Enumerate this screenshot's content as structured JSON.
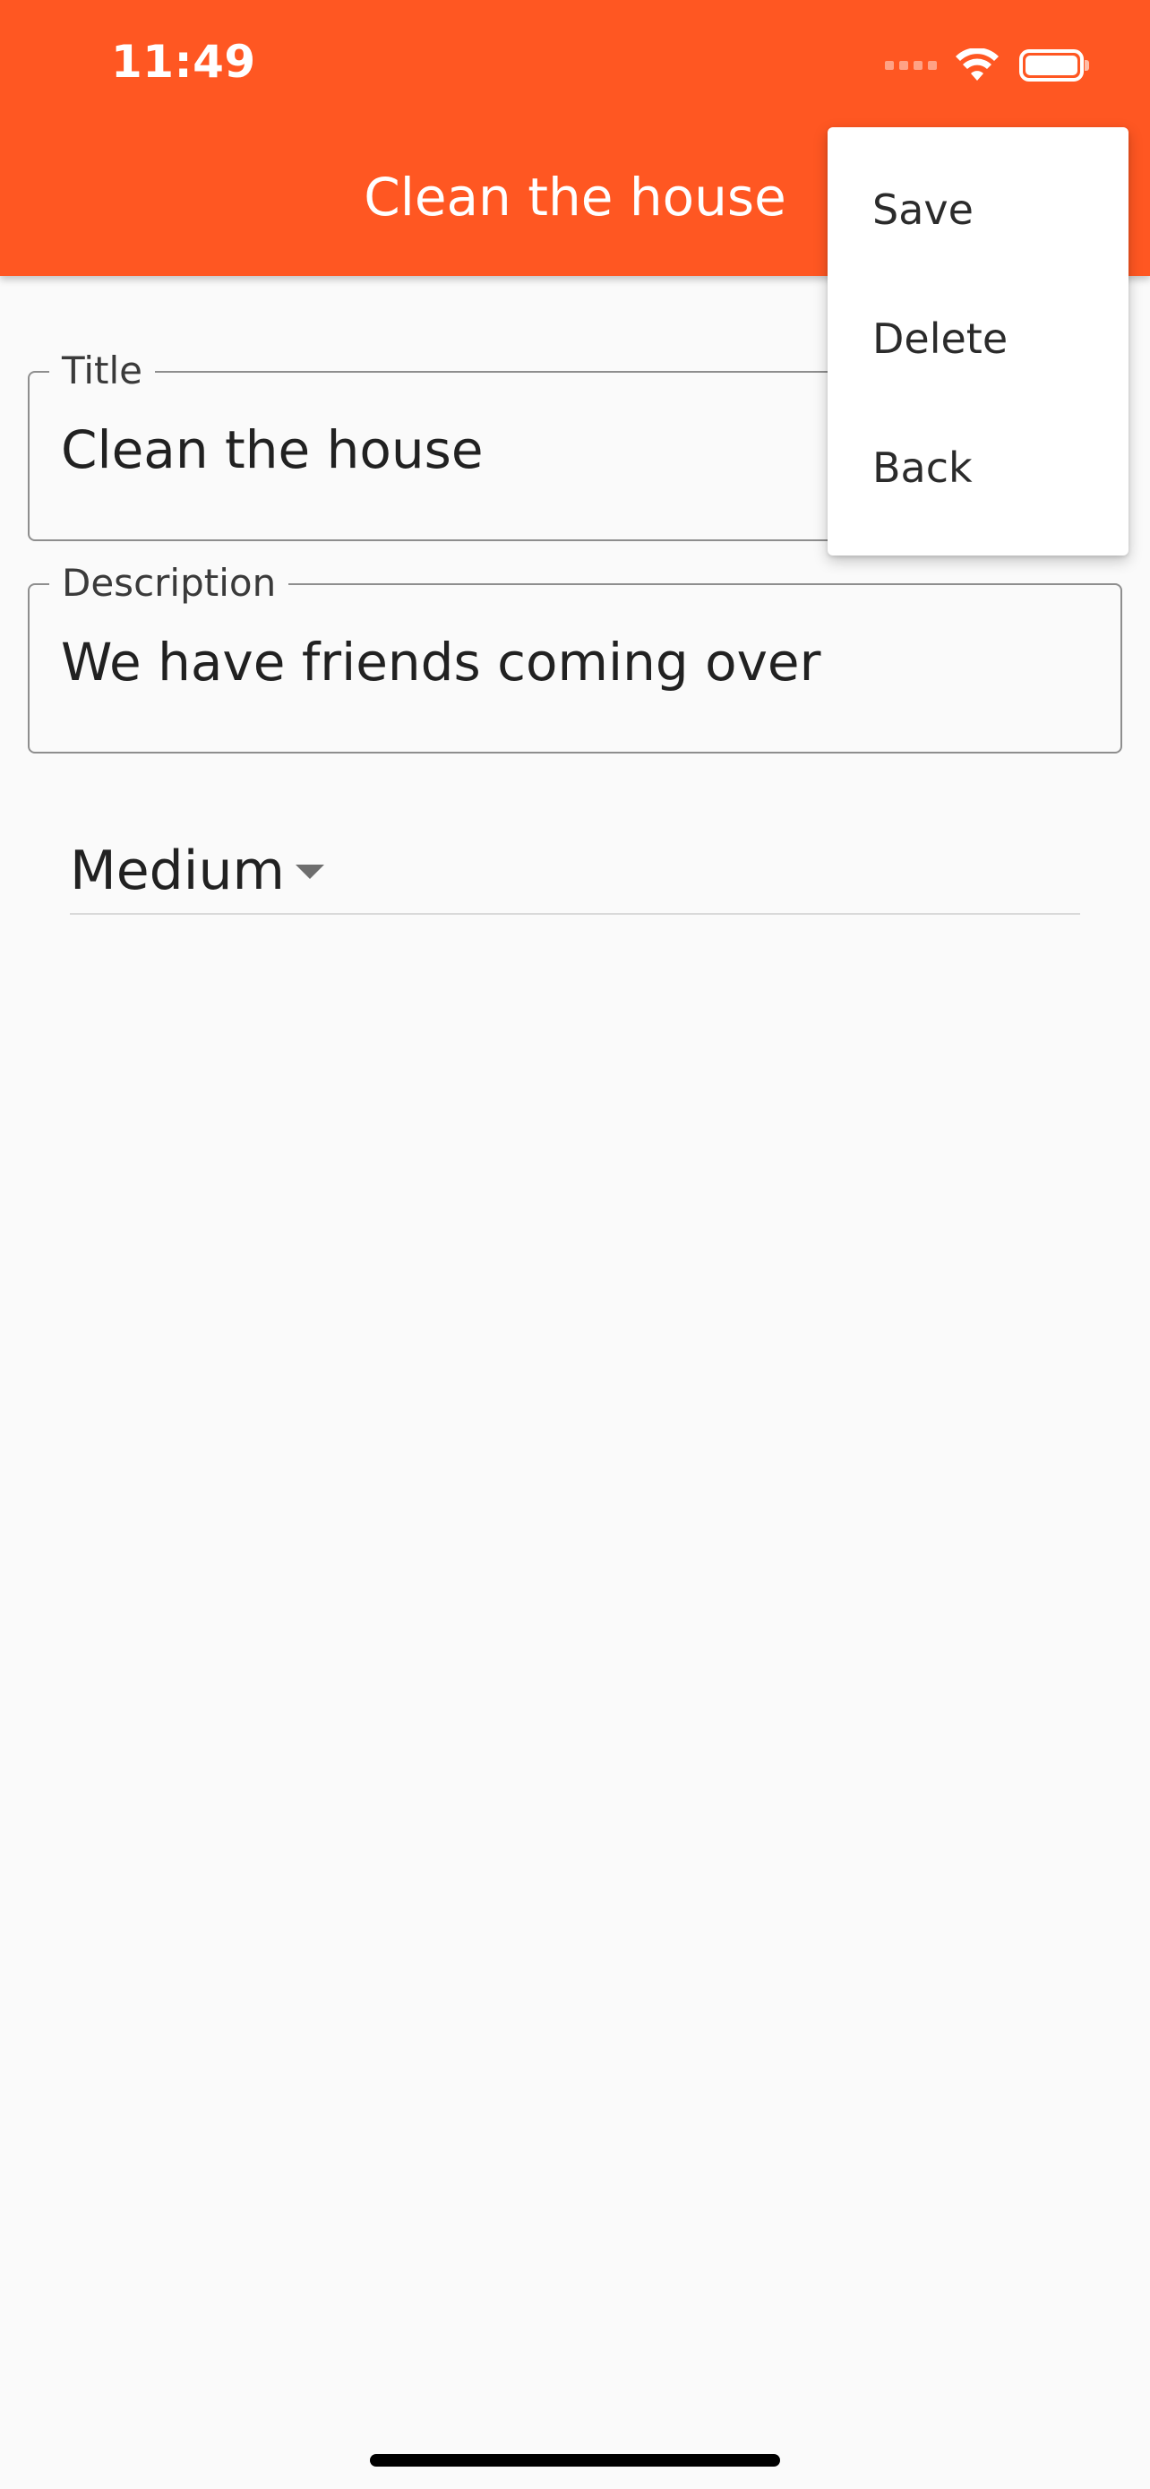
{
  "status_bar": {
    "time": "11:49",
    "icons": [
      "signal-icon",
      "wifi-icon",
      "battery-icon"
    ]
  },
  "app_bar": {
    "title": "Clean the house",
    "background_color": "#ff5722"
  },
  "form": {
    "title_field": {
      "label": "Title",
      "value": "Clean the house"
    },
    "description_field": {
      "label": "Description",
      "value": "We have friends coming over"
    },
    "priority_dropdown": {
      "selected": "Medium",
      "icon": "dropdown-arrow-icon"
    }
  },
  "popup_menu": {
    "items": [
      {
        "label": "Save"
      },
      {
        "label": "Delete"
      },
      {
        "label": "Back"
      }
    ]
  }
}
